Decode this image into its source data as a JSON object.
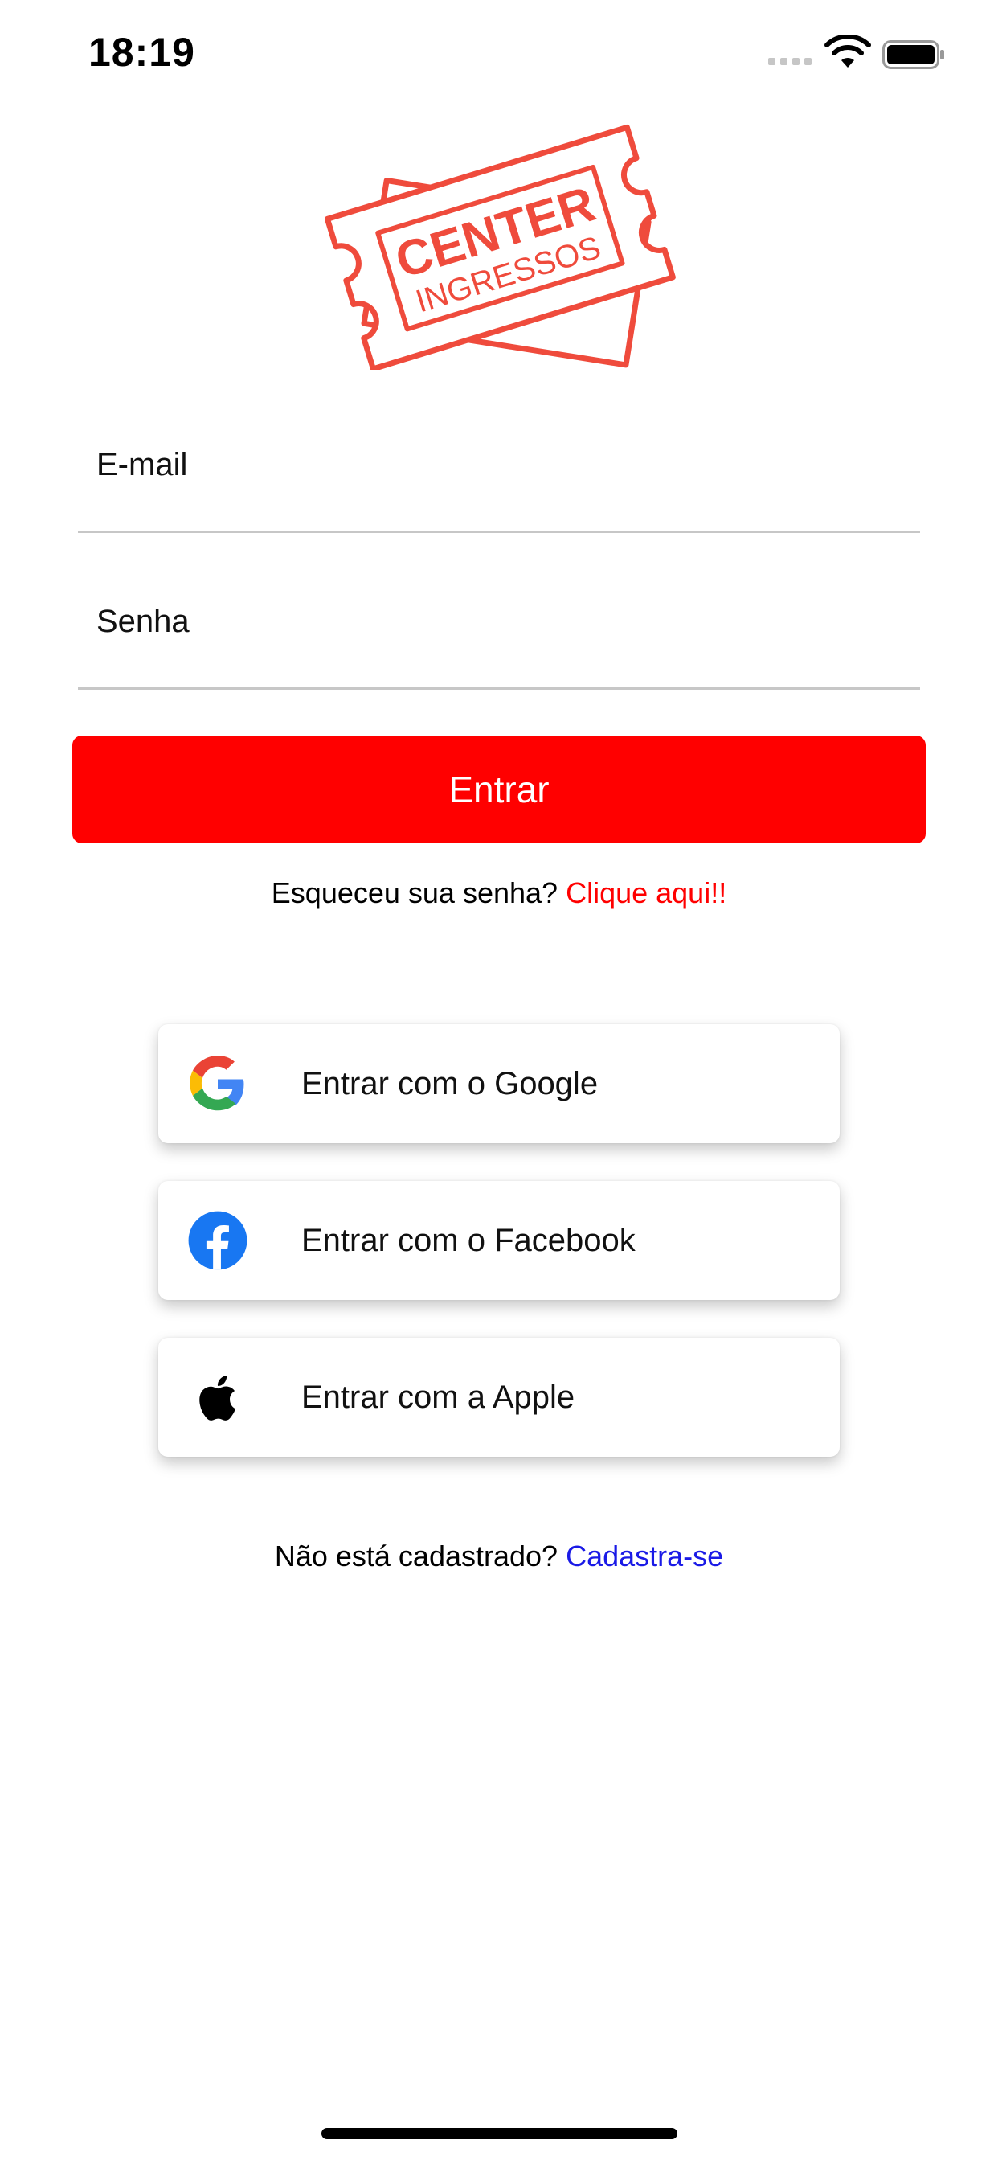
{
  "status_bar": {
    "time": "18:19",
    "icons": [
      "signal-icon",
      "wifi-icon",
      "battery-icon"
    ]
  },
  "logo": {
    "line1": "CENTER",
    "line2": "INGRESSOS",
    "color": "#ef4b3c"
  },
  "form": {
    "email_placeholder": "E-mail",
    "password_placeholder": "Senha",
    "submit_label": "Entrar"
  },
  "forgot": {
    "prompt": "Esqueceu sua senha?",
    "link": "Clique aqui!!"
  },
  "social": [
    {
      "label": "Entrar com o Google",
      "icon": "google-icon"
    },
    {
      "label": "Entrar com o Facebook",
      "icon": "facebook-icon"
    },
    {
      "label": "Entrar com a Apple",
      "icon": "apple-icon"
    }
  ],
  "signup": {
    "prompt": "Não está cadastrado?",
    "link": "Cadastra-se"
  },
  "colors": {
    "primary": "#ff0000",
    "link_blue": "#1a1ae6",
    "facebook": "#1877f2"
  }
}
